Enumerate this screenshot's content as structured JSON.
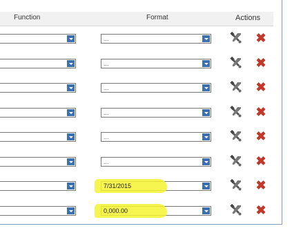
{
  "table": {
    "headers": {
      "function": "Function",
      "format": "Format",
      "actions": "Actions"
    },
    "rows": [
      {
        "format_value": "...",
        "highlight": false
      },
      {
        "format_value": "...",
        "highlight": false
      },
      {
        "format_value": "...",
        "highlight": false
      },
      {
        "format_value": "...",
        "highlight": false
      },
      {
        "format_value": "...",
        "highlight": false
      },
      {
        "format_value": "...",
        "highlight": false
      },
      {
        "format_value": "7/31/2015",
        "highlight": true
      },
      {
        "format_value": "0,000.00",
        "highlight": true
      }
    ],
    "icons": {
      "edit": "tools-icon",
      "delete": "delete-x-icon"
    },
    "colors": {
      "highlight": "#f4f230",
      "dropdown_arrow": "#3c6fb0",
      "delete": "#c0392b"
    }
  }
}
